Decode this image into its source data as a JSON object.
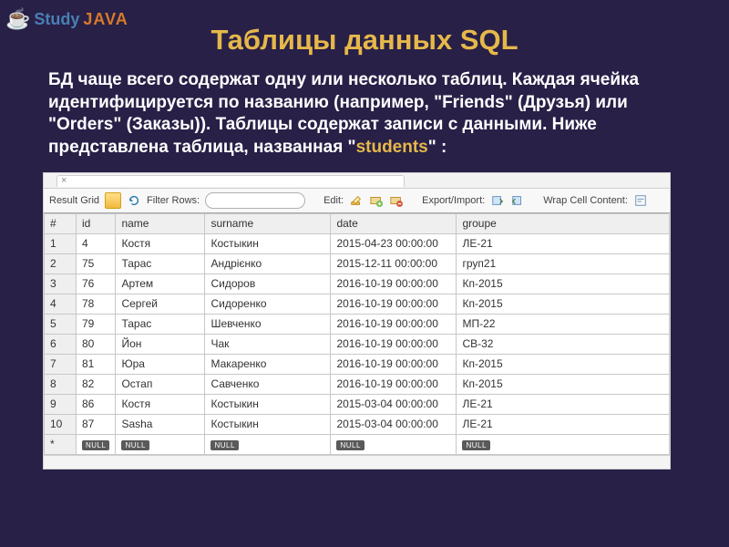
{
  "logo": {
    "study": "Study",
    "java": "JAVA"
  },
  "title": "Таблицы данных SQL",
  "para_before": "БД чаще всего содержат одну или несколько таблиц. Каждая ячейка идентифицируется по названию (например, \"Friends\" (Друзья) или \"Orders\" (Заказы)). Таблицы содержат записи с данными. Ниже представлена таблица, названная \"",
  "para_highlight": "students",
  "para_after": "\" :",
  "toolbar": {
    "result_grid": "Result Grid",
    "filter_rows": "Filter Rows:",
    "filter_placeholder": "",
    "edit": "Edit:",
    "export": "Export/Import:",
    "wrap": "Wrap Cell Content:"
  },
  "columns": [
    "#",
    "id",
    "name",
    "surname",
    "date",
    "groupe"
  ],
  "rows": [
    [
      "1",
      "4",
      "Костя",
      "Костыкин",
      "2015-04-23 00:00:00",
      "ЛЕ-21"
    ],
    [
      "2",
      "75",
      "Тарас",
      "Андрієнко",
      "2015-12-11 00:00:00",
      "груп21"
    ],
    [
      "3",
      "76",
      "Артем",
      "Сидоров",
      "2016-10-19 00:00:00",
      "Кп-2015"
    ],
    [
      "4",
      "78",
      "Сергей",
      "Сидоренко",
      "2016-10-19 00:00:00",
      "Кп-2015"
    ],
    [
      "5",
      "79",
      "Тарас",
      "Шевченко",
      "2016-10-19 00:00:00",
      "МП-22"
    ],
    [
      "6",
      "80",
      "Йон",
      "Чак",
      "2016-10-19 00:00:00",
      "СВ-32"
    ],
    [
      "7",
      "81",
      "Юра",
      "Макаренко",
      "2016-10-19 00:00:00",
      "Кп-2015"
    ],
    [
      "8",
      "82",
      "Остап",
      "Савченко",
      "2016-10-19 00:00:00",
      "Кп-2015"
    ],
    [
      "9",
      "86",
      "Костя",
      "Костыкин",
      "2015-03-04 00:00:00",
      "ЛЕ-21"
    ],
    [
      "10",
      "87",
      "Sasha",
      "Костыкин",
      "2015-03-04 00:00:00",
      "ЛЕ-21"
    ]
  ],
  "null_label": "NULL",
  "star": "*"
}
